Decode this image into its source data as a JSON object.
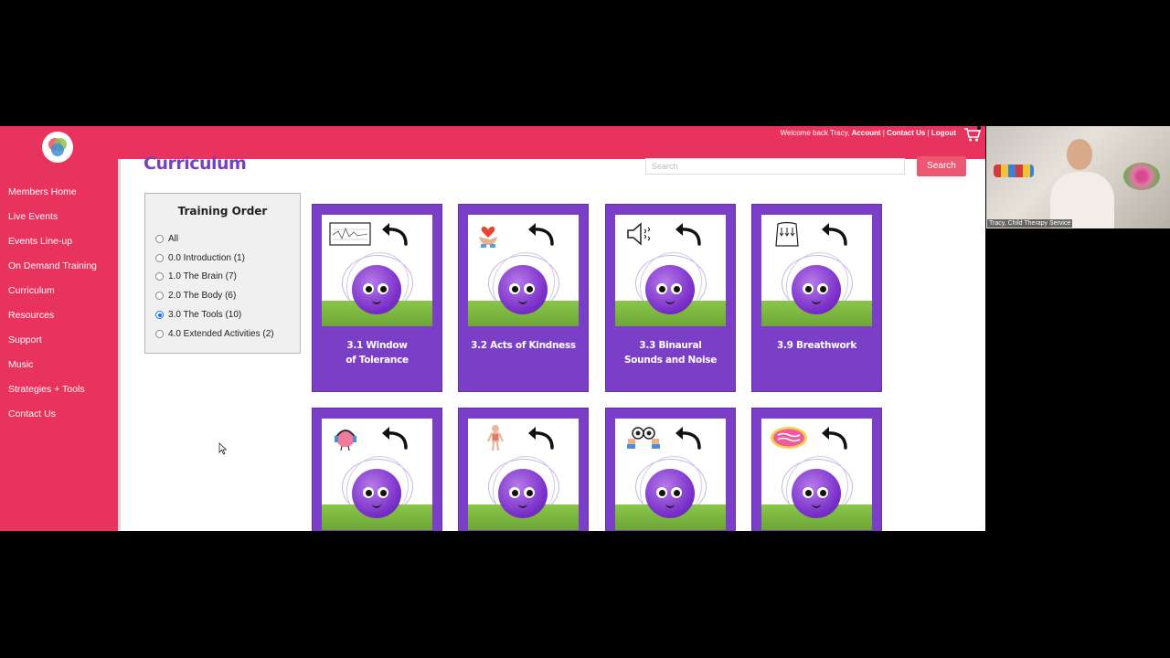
{
  "header": {
    "welcome_text": "Welcome back Tracy,",
    "account_link": "Account",
    "contact_link": "Contact Us",
    "logout_link": "Logout",
    "separator": "|"
  },
  "sidebar": {
    "items": [
      {
        "label": "Members Home"
      },
      {
        "label": "Live Events"
      },
      {
        "label": "Events Line-up"
      },
      {
        "label": "On Demand Training"
      },
      {
        "label": "Curriculum"
      },
      {
        "label": "Resources"
      },
      {
        "label": "Support"
      },
      {
        "label": "Music"
      },
      {
        "label": "Strategies + Tools"
      },
      {
        "label": "Contact Us"
      }
    ]
  },
  "main": {
    "title": "Curriculum",
    "search": {
      "placeholder": "Search",
      "button_label": "Search"
    }
  },
  "filter": {
    "title": "Training Order",
    "options": [
      {
        "label": "All",
        "checked": false
      },
      {
        "label": "0.0 Introduction (1)",
        "checked": false
      },
      {
        "label": "1.0 The Brain (7)",
        "checked": false
      },
      {
        "label": "2.0 The Body (6)",
        "checked": false
      },
      {
        "label": "3.0 The Tools (10)",
        "checked": true
      },
      {
        "label": "4.0 Extended Activities (2)",
        "checked": false
      }
    ]
  },
  "cards": [
    {
      "line1": "3.1 Window",
      "line2": "of Tolerance",
      "icon": "window-of-tolerance-chart-icon"
    },
    {
      "line1": "3.2 Acts of Kindness",
      "line2": "",
      "icon": "heart-in-hands-icon"
    },
    {
      "line1": "3.3 Binaural",
      "line2": "Sounds and Noise",
      "icon": "speaker-sound-icon"
    },
    {
      "line1": "3.9 Breathwork",
      "line2": "",
      "icon": "body-breathing-icon"
    },
    {
      "line1": "",
      "line2": "",
      "icon": "brain-headphones-icon"
    },
    {
      "line1": "",
      "line2": "",
      "icon": "human-body-icon"
    },
    {
      "line1": "",
      "line2": "",
      "icon": "eyes-hands-icon"
    },
    {
      "line1": "",
      "line2": "",
      "icon": "you-are-enough-icon"
    }
  ],
  "video": {
    "caption": "Tracy, Child Therapy Service"
  },
  "colors": {
    "brand_pink": "#e8335e",
    "card_purple": "#7a3fc6",
    "title_purple": "#7b3fc4",
    "search_button": "#ec5772"
  }
}
